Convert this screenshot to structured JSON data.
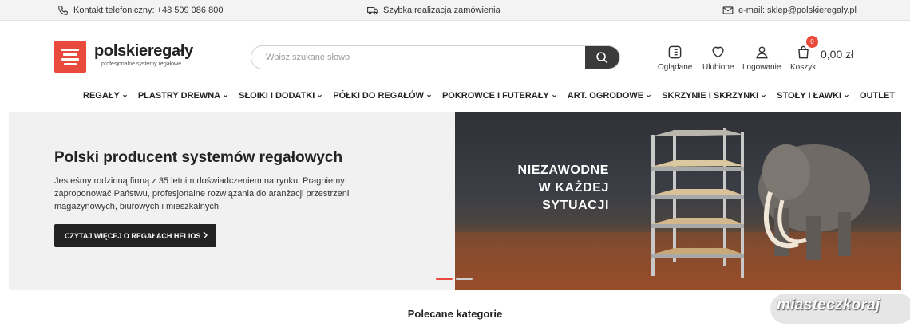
{
  "topbar": {
    "phone": "Kontakt telefoniczny: +48 509 086 800",
    "fast_delivery": "Szybka realizacja zamówienia",
    "email": "e-mail: sklep@polskieregaly.pl"
  },
  "header": {
    "logo_name": "polskieregały",
    "logo_tagline": "profesjonalne systemy regałowe",
    "search_placeholder": "Wpisz szukane słowo",
    "icons": {
      "viewed": "Oglądane",
      "favorites": "Ulubione",
      "login": "Logowanie",
      "cart": "Koszyk"
    },
    "cart_count": "0",
    "cart_total": "0,00 zł"
  },
  "nav": {
    "items": [
      {
        "label": "REGAŁY"
      },
      {
        "label": "PLASTRY DREWNA"
      },
      {
        "label": "SŁOIKI I DODATKI"
      },
      {
        "label": "PÓŁKI DO REGAŁÓW"
      },
      {
        "label": "POKROWCE I FUTERAŁY"
      },
      {
        "label": "ART. OGRODOWE"
      },
      {
        "label": "SKRZYNIE I SKRZYNKI"
      },
      {
        "label": "STOŁY I ŁAWKI"
      },
      {
        "label": "OUTLET"
      }
    ]
  },
  "banner": {
    "title": "Polski producent systemów regałowych",
    "description": "Jesteśmy rodzinną firmą z 35 letnim doświadczeniem na rynku. Pragniemy zaproponować Państwu, profesjonalne rozwiązania do aranżacji przestrzeni magazynowych, biurowych i mieszkalnych.",
    "button": "CZYTAJ WIĘCEJ O REGAŁACH HELIOS",
    "slogan_line1": "NIEZAWODNE",
    "slogan_line2": "W KAŻDEJ",
    "slogan_line3": "SYTUACJI"
  },
  "section_title": "Polecane kategorie",
  "watermark": "miasteczkoraj",
  "colors": {
    "accent": "#e84a3b",
    "dark": "#232323",
    "banner_bg": "#f1f1f1"
  }
}
